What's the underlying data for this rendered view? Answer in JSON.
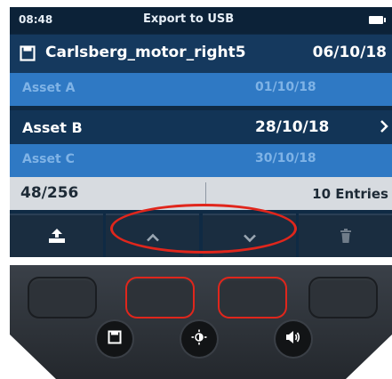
{
  "status_bar": {
    "time": "08:48",
    "title": "Export to USB",
    "battery_icon": "battery-icon"
  },
  "file": {
    "icon": "save-icon",
    "name": "Carlsberg_motor_right5",
    "date": "06/10/18"
  },
  "assets": [
    {
      "name": "Asset A",
      "date": "01/10/18",
      "selected": false
    },
    {
      "name": "Asset B",
      "date": "28/10/18",
      "selected": true
    },
    {
      "name": "Asset C",
      "date": "30/10/18",
      "selected": false
    }
  ],
  "footer": {
    "count": "48/256",
    "entries": "10 Entries"
  },
  "softkeys": [
    {
      "icon": "export-icon"
    },
    {
      "icon": "chevron-up-icon"
    },
    {
      "icon": "chevron-down-icon"
    },
    {
      "icon": "trash-icon"
    }
  ],
  "hardware_buttons": [
    {
      "icon": "save-icon"
    },
    {
      "icon": "brightness-icon"
    },
    {
      "icon": "volume-icon"
    }
  ],
  "colors": {
    "accent_highlight": "#e0261c",
    "screen_bg": "#0f2a44",
    "selected_row": "#123456",
    "dim_row": "#2f79c4"
  }
}
